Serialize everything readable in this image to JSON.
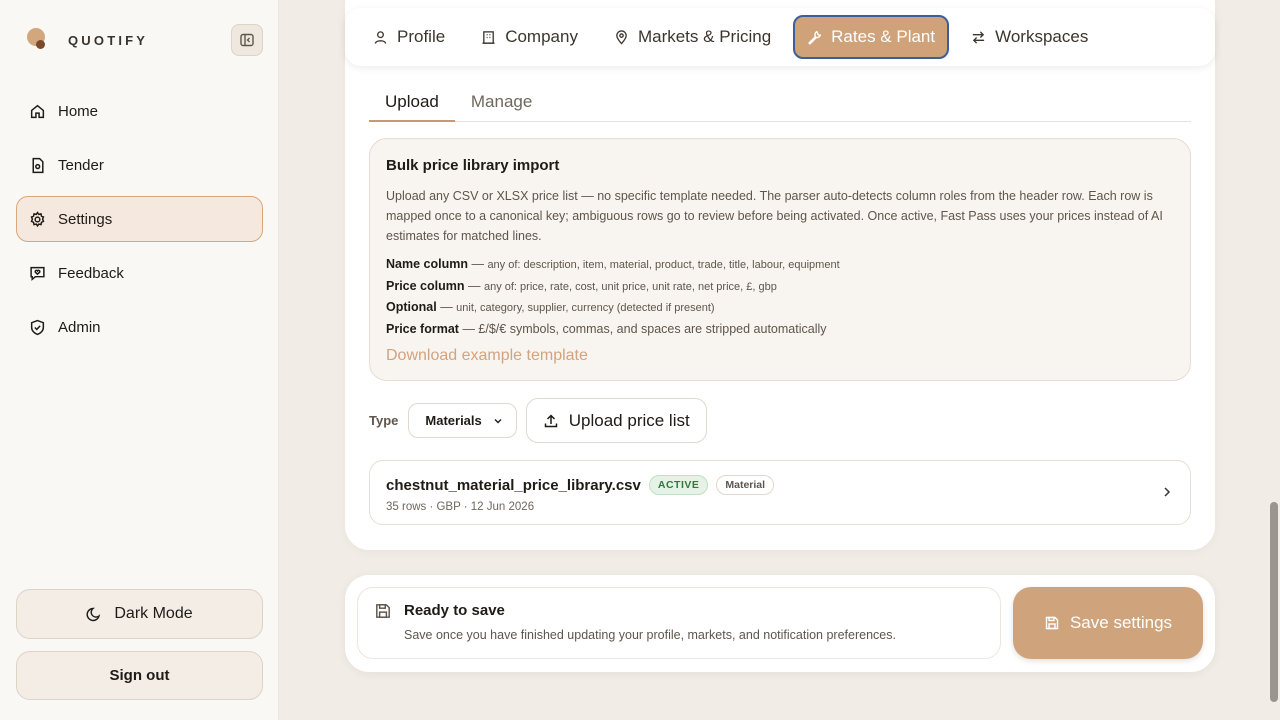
{
  "brand": {
    "name": "QUOTIFY"
  },
  "sidebar": {
    "items": [
      {
        "label": "Home",
        "icon": "home-icon"
      },
      {
        "label": "Tender",
        "icon": "document-icon"
      },
      {
        "label": "Settings",
        "icon": "gear-icon",
        "active": true
      },
      {
        "label": "Feedback",
        "icon": "feedback-icon"
      },
      {
        "label": "Admin",
        "icon": "shield-icon"
      }
    ],
    "dark_mode_label": "Dark Mode",
    "sign_out_label": "Sign out"
  },
  "topnav": {
    "tabs": [
      {
        "label": "Profile",
        "icon": "user-icon"
      },
      {
        "label": "Company",
        "icon": "building-icon"
      },
      {
        "label": "Markets & Pricing",
        "icon": "pin-icon"
      },
      {
        "label": "Rates & Plant",
        "icon": "wrench-icon",
        "active": true
      },
      {
        "label": "Workspaces",
        "icon": "swap-icon"
      }
    ]
  },
  "subtabs": {
    "upload": "Upload",
    "manage": "Manage",
    "active": "Upload"
  },
  "import": {
    "title": "Bulk price library import",
    "description": "Upload any CSV or XLSX price list — no specific template needed. The parser auto-detects column roles from the header row. Each row is mapped once to a canonical key; ambiguous rows go to review before being activated. Once active, Fast Pass uses your prices instead of AI estimates for matched lines.",
    "rules": [
      {
        "label": "Name column",
        "text": "any of: description, item, material, product, trade, title, labour, equipment"
      },
      {
        "label": "Price column",
        "text": "any of: price, rate, cost, unit price, unit rate, net price, £, gbp"
      },
      {
        "label": "Optional",
        "text": "unit, category, supplier, currency (detected if present)"
      },
      {
        "label": "Price format",
        "text": "£/$/€ symbols, commas, and spaces are stripped automatically"
      }
    ],
    "rule_separator": "—",
    "download_link": "Download example template"
  },
  "upload": {
    "type_label": "Type",
    "type_value": "Materials",
    "button_label": "Upload price list"
  },
  "files": [
    {
      "name": "chestnut_material_price_library.csv",
      "status": "ACTIVE",
      "type": "Material",
      "meta": "35 rows · GBP · 12 Jun 2026"
    }
  ],
  "savebar": {
    "title": "Ready to save",
    "description": "Save once you have finished updating your profile, markets, and notification preferences.",
    "button_label": "Save settings"
  },
  "colors": {
    "accent": "#cfa27a",
    "active_border": "#3b5f9a",
    "link": "#d4a37e",
    "status_active": "#2f7a3c"
  }
}
